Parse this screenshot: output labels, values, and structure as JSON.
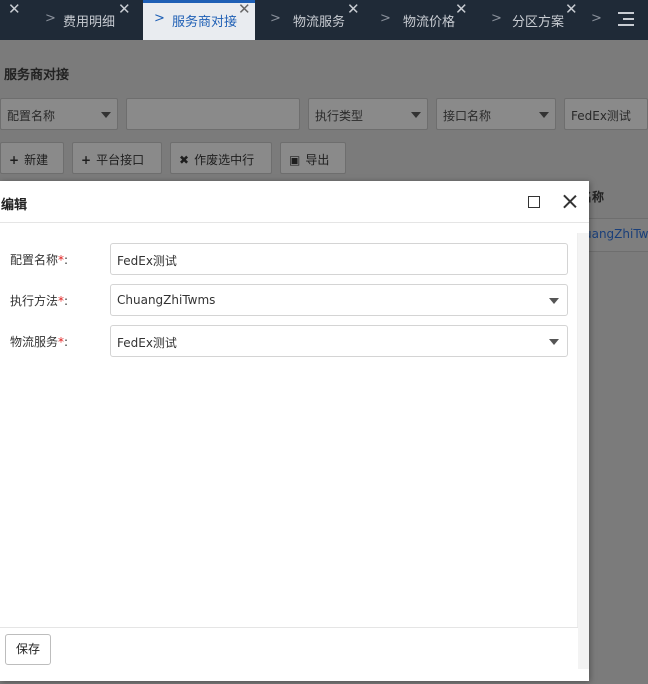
{
  "tabs": [
    {
      "label": "",
      "active": false
    },
    {
      "label": "费用明细",
      "active": false
    },
    {
      "label": "服务商对接",
      "active": true
    },
    {
      "label": "物流服务",
      "active": false
    },
    {
      "label": "物流价格",
      "active": false
    },
    {
      "label": "分区方案",
      "active": false
    }
  ],
  "page": {
    "title": "服务商对接",
    "filters": {
      "config_name": "配置名称",
      "blank_input": "",
      "exec_type": "执行类型",
      "api_name": "接口名称",
      "last_value": "FedEx测试"
    },
    "toolbar": {
      "new_label": "新建",
      "platform_label": "平台接口",
      "void_label": "作废选中行",
      "export_label": "导出"
    },
    "grid": {
      "col_header": "名称",
      "cell_value": "ChuangZhiTwms"
    }
  },
  "modal": {
    "title": "编辑",
    "fields": [
      {
        "label": "配置名称",
        "required": "*",
        "colon": ":",
        "value": "FedEx测试",
        "type": "text"
      },
      {
        "label": "执行方法",
        "required": "*",
        "colon": ":",
        "value": "ChuangZhiTwms",
        "type": "select"
      },
      {
        "label": "物流服务",
        "required": "*",
        "colon": ":",
        "value": "FedEx测试",
        "type": "select"
      }
    ],
    "save_label": "保存"
  }
}
